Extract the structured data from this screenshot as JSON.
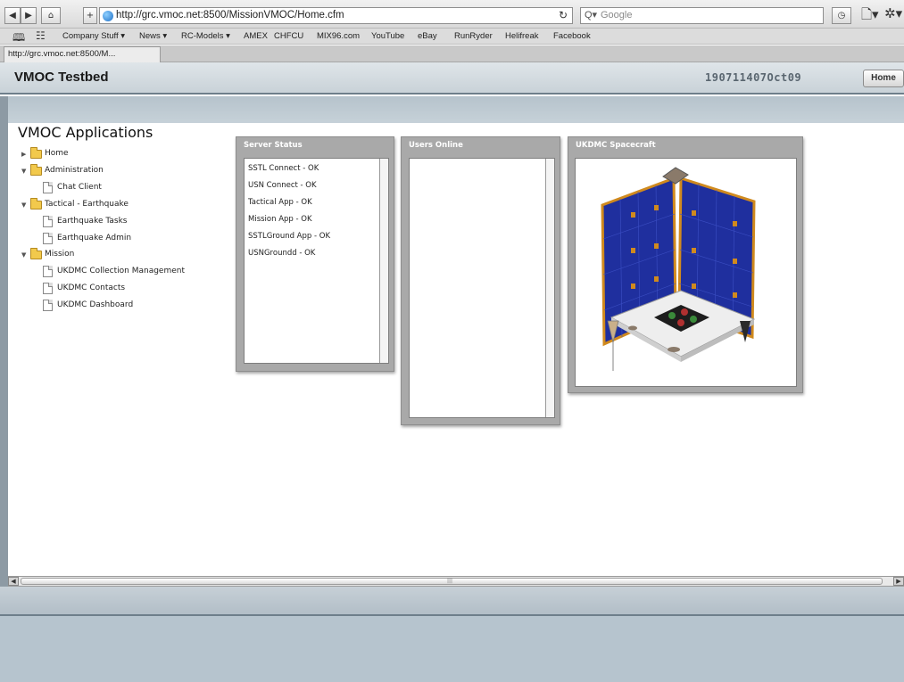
{
  "browser": {
    "url": "http://grc.vmoc.net:8500/MissionVMOC/Home.cfm",
    "search_placeholder": "Google",
    "bookmarks": [
      "Company Stuff ▾",
      "News ▾",
      "RC-Models ▾",
      "AMEX",
      "CHFCU",
      "MIX96.com",
      "YouTube",
      "eBay",
      "RunRyder",
      "Helifreak",
      "Facebook"
    ],
    "tab_title": "http://grc.vmoc.net:8500/M..."
  },
  "app": {
    "title": "VMOC Testbed",
    "dtg": "190711407Oct09",
    "home_label": "Home"
  },
  "tree": {
    "title": "VMOC Applications",
    "items": [
      {
        "label": "Home"
      },
      {
        "label": "Administration"
      },
      {
        "label": "Chat Client"
      },
      {
        "label": "Tactical - Earthquake"
      },
      {
        "label": "Earthquake Tasks"
      },
      {
        "label": "Earthquake Admin"
      },
      {
        "label": "Mission"
      },
      {
        "label": "UKDMC Collection Management"
      },
      {
        "label": "UKDMC Contacts"
      },
      {
        "label": "UKDMC Dashboard"
      }
    ]
  },
  "panels": {
    "server_status": {
      "title": "Server Status",
      "lines": [
        "SSTL Connect - OK",
        "USN Connect - OK",
        "Tactical App - OK",
        "Mission App - OK",
        "SSTLGround App - OK",
        "USNGroundd - OK"
      ]
    },
    "users_online": {
      "title": "Users Online"
    },
    "spacecraft": {
      "title": "UKDMC Spacecraft"
    }
  },
  "colors": {
    "header_border": "#6e7f8b",
    "panel_gray": "#a9a9a9",
    "solar_panel": "#1f2f9e",
    "gold_frame": "#d08a1e"
  }
}
